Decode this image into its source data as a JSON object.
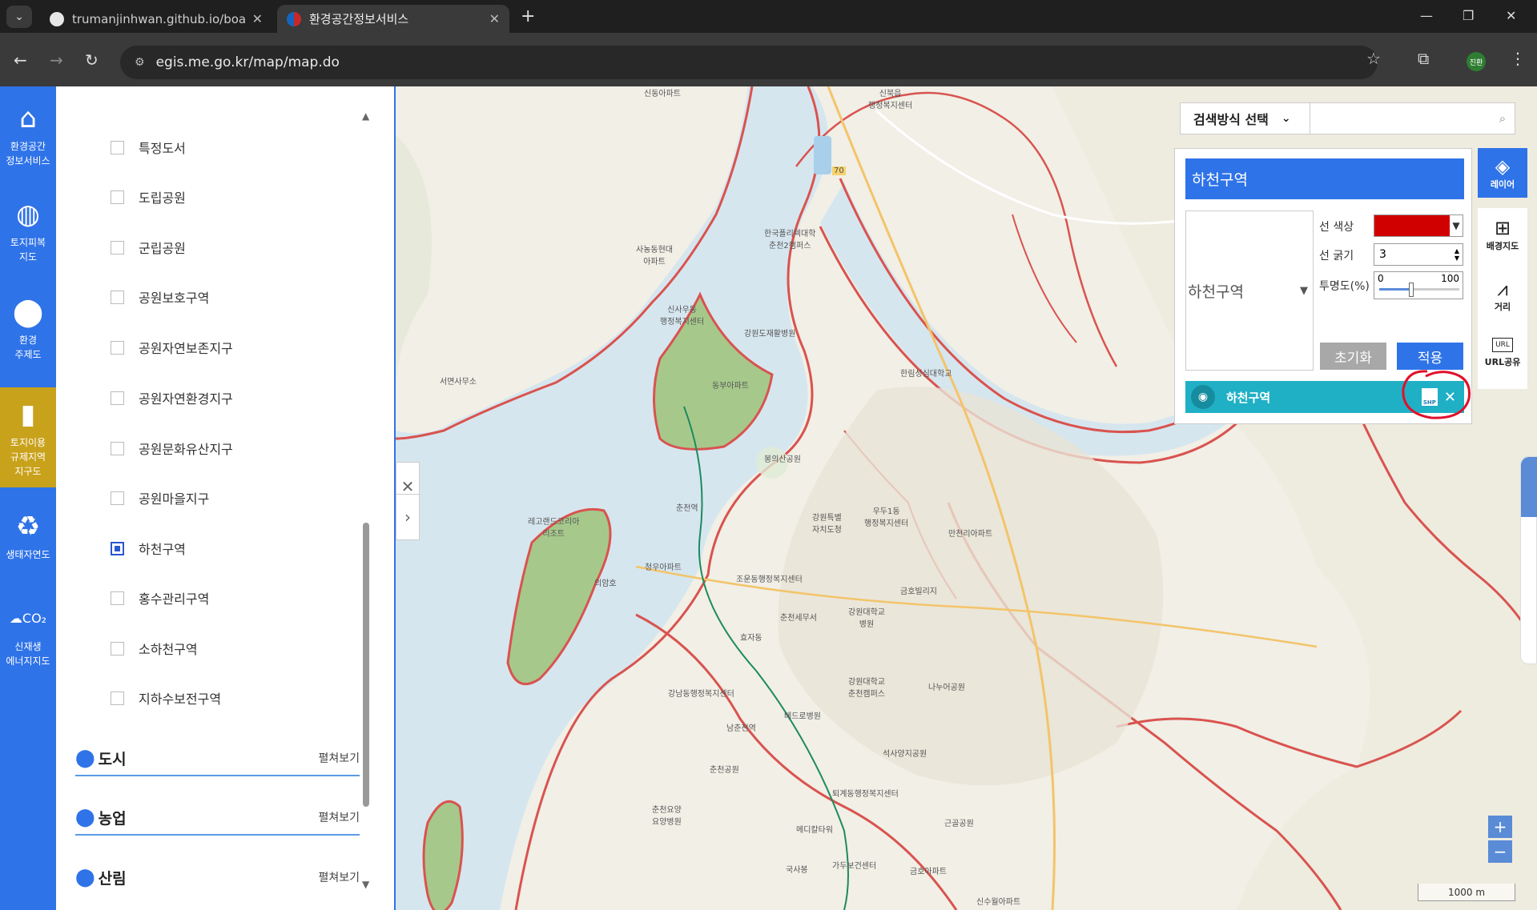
{
  "browser": {
    "tabs": [
      {
        "title": "trumanjinhwan.github.io/board",
        "icon": "github-icon"
      },
      {
        "title": "환경공간정보서비스",
        "icon": "site-icon"
      }
    ],
    "url": "egis.me.go.kr/map/map.do",
    "profile_initials": "진환"
  },
  "left_nav": {
    "items": [
      {
        "label": "환경공간\n정보서비스",
        "icon": "home-icon"
      },
      {
        "label": "토지피복\n지도",
        "icon": "globe-icon"
      },
      {
        "label": "환경\n주제도",
        "icon": "map-pin-icon"
      },
      {
        "label": "토지이용\n규제지역\n지구도",
        "icon": "book-icon",
        "active": true
      },
      {
        "label": "생태자연도",
        "icon": "eco-cycle-icon"
      },
      {
        "label": "신재생\n에너지지도",
        "icon": "co2-icon"
      }
    ]
  },
  "layer_list": {
    "items": [
      {
        "label": "특정도서",
        "checked": false
      },
      {
        "label": "도립공원",
        "checked": false
      },
      {
        "label": "군립공원",
        "checked": false
      },
      {
        "label": "공원보호구역",
        "checked": false
      },
      {
        "label": "공원자연보존지구",
        "checked": false
      },
      {
        "label": "공원자연환경지구",
        "checked": false
      },
      {
        "label": "공원문화유산지구",
        "checked": false
      },
      {
        "label": "공원마을지구",
        "checked": false
      },
      {
        "label": "하천구역",
        "checked": true
      },
      {
        "label": "홍수관리구역",
        "checked": false
      },
      {
        "label": "소하천구역",
        "checked": false
      },
      {
        "label": "지하수보전구역",
        "checked": false
      }
    ],
    "categories": [
      {
        "label": "도시",
        "expand": "펼쳐보기"
      },
      {
        "label": "농업",
        "expand": "펼쳐보기"
      },
      {
        "label": "산림",
        "expand": "펼쳐보기"
      }
    ]
  },
  "search": {
    "method_label": "검색방식 선택",
    "placeholder": ""
  },
  "style_panel": {
    "title": "하천구역",
    "layer_select": "하천구역",
    "line_color_label": "선 색상",
    "line_color": "#d00000",
    "line_width_label": "선 굵기",
    "line_width": "3",
    "opacity_label": "투명도(%)",
    "opacity_min": "0",
    "opacity_max": "100",
    "opacity_value": 0.4,
    "reset_label": "초기화",
    "apply_label": "적용",
    "active_layer": "하천구역",
    "shp_label": "SHP"
  },
  "right_tools": {
    "layer": "레이어",
    "basemap": "배경지도",
    "distance": "거리",
    "url_share": "URL공유",
    "url_icon_text": "URL"
  },
  "map": {
    "scale": "1000 m",
    "labels": [
      "신동아파트",
      "신북읍\n행정복지센터",
      "서면사무소",
      "사농동현대\n아파트",
      "한국폴리텍대학\n춘천2캠퍼스",
      "신사우동\n행정복지센터",
      "강원도재활병원",
      "한림성심대학교",
      "동부아파트",
      "봉의산공원",
      "춘천역",
      "레고랜드코리아\n리조트",
      "강원특별\n자치도청",
      "우두1동\n행정복지센터",
      "만천리아파트",
      "청우아파트",
      "조운동행정복지센터",
      "금호빌리지",
      "춘천세무서",
      "강원대학교\n병원",
      "효자동",
      "강원대학교\n춘천캠퍼스",
      "나누어공원",
      "강남동행정복지센터",
      "남춘천역",
      "석사양지공원",
      "베드로병원",
      "춘천공원",
      "퇴계동행정복지센터",
      "춘천요양\n요양병원",
      "메디칼타워",
      "근골공원",
      "가두보건센터",
      "국사봉",
      "금호아파트",
      "신수월아파트",
      "의암호",
      "70"
    ]
  },
  "colors": {
    "nav_blue": "#2f73e8",
    "nav_active": "#c9a21b",
    "river": "#d6e6ef",
    "boundary": "#d9534f",
    "green_island": "#a6c98b",
    "layer_item": "#1fb0c6"
  }
}
